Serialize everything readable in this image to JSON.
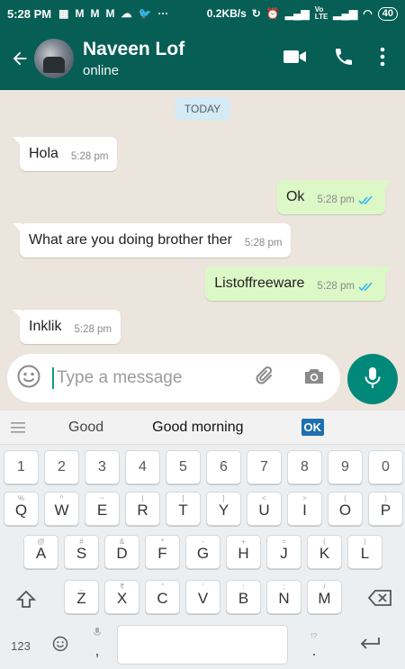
{
  "status_bar": {
    "time": "5:28 PM",
    "speed": "0.2KB/s",
    "battery": "40"
  },
  "header": {
    "contact_name": "Naveen Lof",
    "contact_status": "online"
  },
  "chat": {
    "date_chip": "TODAY",
    "messages": [
      {
        "text": "Hola",
        "time": "5:28 pm",
        "direction": "in"
      },
      {
        "text": "Ok",
        "time": "5:28 pm",
        "direction": "out",
        "read": true
      },
      {
        "text": "What are you doing brother ther",
        "time": "5:28 pm",
        "direction": "in"
      },
      {
        "text": "Listoffreeware",
        "time": "5:28 pm",
        "direction": "out",
        "read": true
      },
      {
        "text": "Inklik",
        "time": "5:28 pm",
        "direction": "in"
      }
    ]
  },
  "input": {
    "placeholder": "Type a message"
  },
  "suggestions": {
    "s1": "Good",
    "s2": "Good morning",
    "ok": "OK"
  },
  "keyboard": {
    "numbers": [
      "1",
      "2",
      "3",
      "4",
      "5",
      "6",
      "7",
      "8",
      "9",
      "0"
    ],
    "row1": [
      [
        "Q",
        "%"
      ],
      [
        "W",
        "^"
      ],
      [
        "E",
        "~"
      ],
      [
        "R",
        "|"
      ],
      [
        "T",
        "["
      ],
      [
        "Y",
        "]"
      ],
      [
        "U",
        "<"
      ],
      [
        "I",
        ">"
      ],
      [
        "O",
        "("
      ],
      [
        "P",
        ")"
      ]
    ],
    "row2": [
      [
        "A",
        "@"
      ],
      [
        "S",
        "#"
      ],
      [
        "D",
        "&"
      ],
      [
        "F",
        "*"
      ],
      [
        "G",
        "-"
      ],
      [
        "H",
        "+"
      ],
      [
        "J",
        "="
      ],
      [
        "K",
        "("
      ],
      [
        "L",
        ")"
      ]
    ],
    "row3": [
      [
        "Z",
        "_"
      ],
      [
        "X",
        "₹"
      ],
      [
        "C",
        "\""
      ],
      [
        "V",
        "'"
      ],
      [
        "B",
        ":"
      ],
      [
        "N",
        ";"
      ],
      [
        "M",
        "/"
      ]
    ],
    "num_switch": "123",
    "comma": ",",
    "period": "."
  },
  "colors": {
    "header": "#075e54",
    "accent": "#00897b",
    "outgoing": "#dcf8c6",
    "tick_blue": "#34b7f1"
  }
}
